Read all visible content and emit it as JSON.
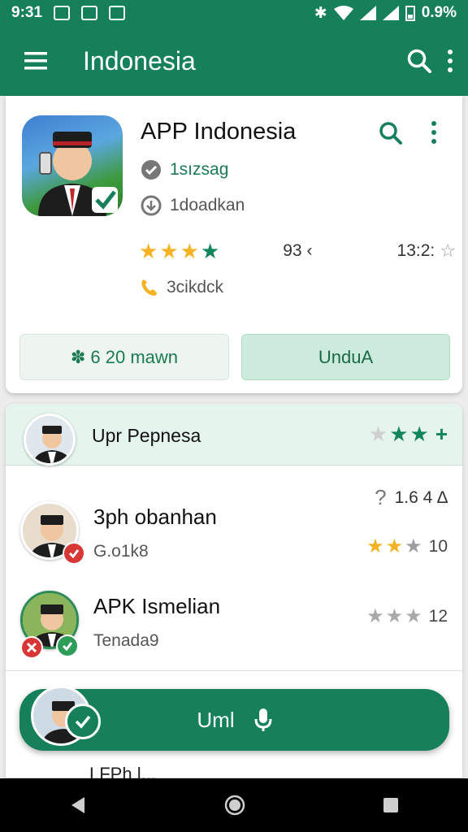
{
  "status_bar": {
    "time": "9:31",
    "battery": "0.9%"
  },
  "app_bar": {
    "title": "Indonesia"
  },
  "app_card": {
    "title": "APP Indonesia",
    "meta1": "1sızsag",
    "meta2": "1doadkan",
    "rating_value": "93 ‹",
    "rating_time": "13:2:",
    "meta3": "3cikdck",
    "secondary_button": "6 20 mawn",
    "primary_button": "UnduA"
  },
  "list": {
    "header": {
      "label": "Upr Pepnesa"
    },
    "top_number": "1.6 4 ∆",
    "items": [
      {
        "name": "3ph obanhan",
        "sub": "G.o1k8",
        "count": "10"
      },
      {
        "name": "APK Ismelian",
        "sub": "Tenada9",
        "count": "12"
      }
    ]
  },
  "fab": {
    "label": "Uml"
  },
  "peek": {
    "text": "LFPh l..."
  },
  "colors": {
    "primary": "#16805a",
    "star_gold": "#f5b324",
    "star_green": "#13855a",
    "star_grey": "#bdbdbd"
  },
  "icons": [
    "menu-icon",
    "search-icon",
    "more-vert-icon",
    "check-icon",
    "mic-icon",
    "back-icon",
    "home-icon",
    "recents-icon"
  ]
}
